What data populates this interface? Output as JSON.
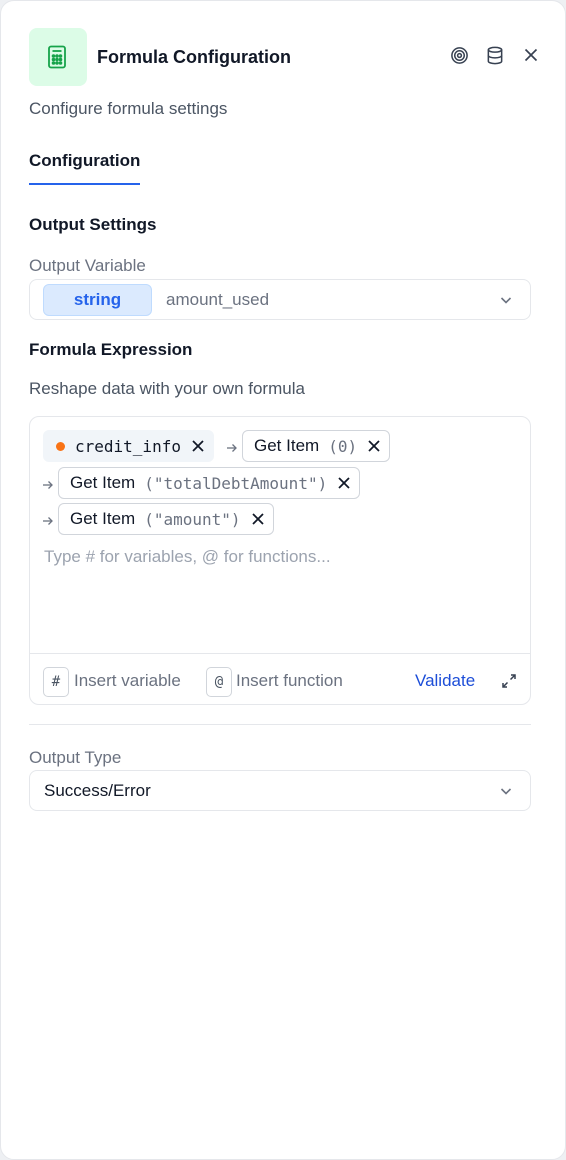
{
  "header": {
    "title": "Formula Configuration",
    "subtitle": "Configure formula settings",
    "icon": "calculator-icon",
    "accent_bg": "#dcfce7",
    "accent_fg": "#16a34a",
    "actions": [
      "target-icon",
      "database-icon",
      "close-icon"
    ]
  },
  "tabs": {
    "active": "Configuration"
  },
  "output_settings": {
    "section_title": "Output Settings",
    "variable_label": "Output Variable",
    "variable_type": "string",
    "variable_name": "amount_used"
  },
  "formula": {
    "section_title": "Formula Expression",
    "helper": "Reshape data with your own formula",
    "variable_chip": "credit_info",
    "variable_color": "#f97316",
    "steps": [
      {
        "fn": "Get Item",
        "arg": "(0)"
      },
      {
        "fn": "Get Item",
        "arg": "(\"totalDebtAmount\")"
      },
      {
        "fn": "Get Item",
        "arg": "(\"amount\")"
      }
    ],
    "placeholder": "Type # for variables, @ for functions...",
    "toolbar": {
      "var_key": "#",
      "insert_variable": "Insert variable",
      "fn_key": "@",
      "insert_function": "Insert function",
      "validate": "Validate"
    }
  },
  "output_type": {
    "label": "Output Type",
    "value": "Success/Error"
  }
}
